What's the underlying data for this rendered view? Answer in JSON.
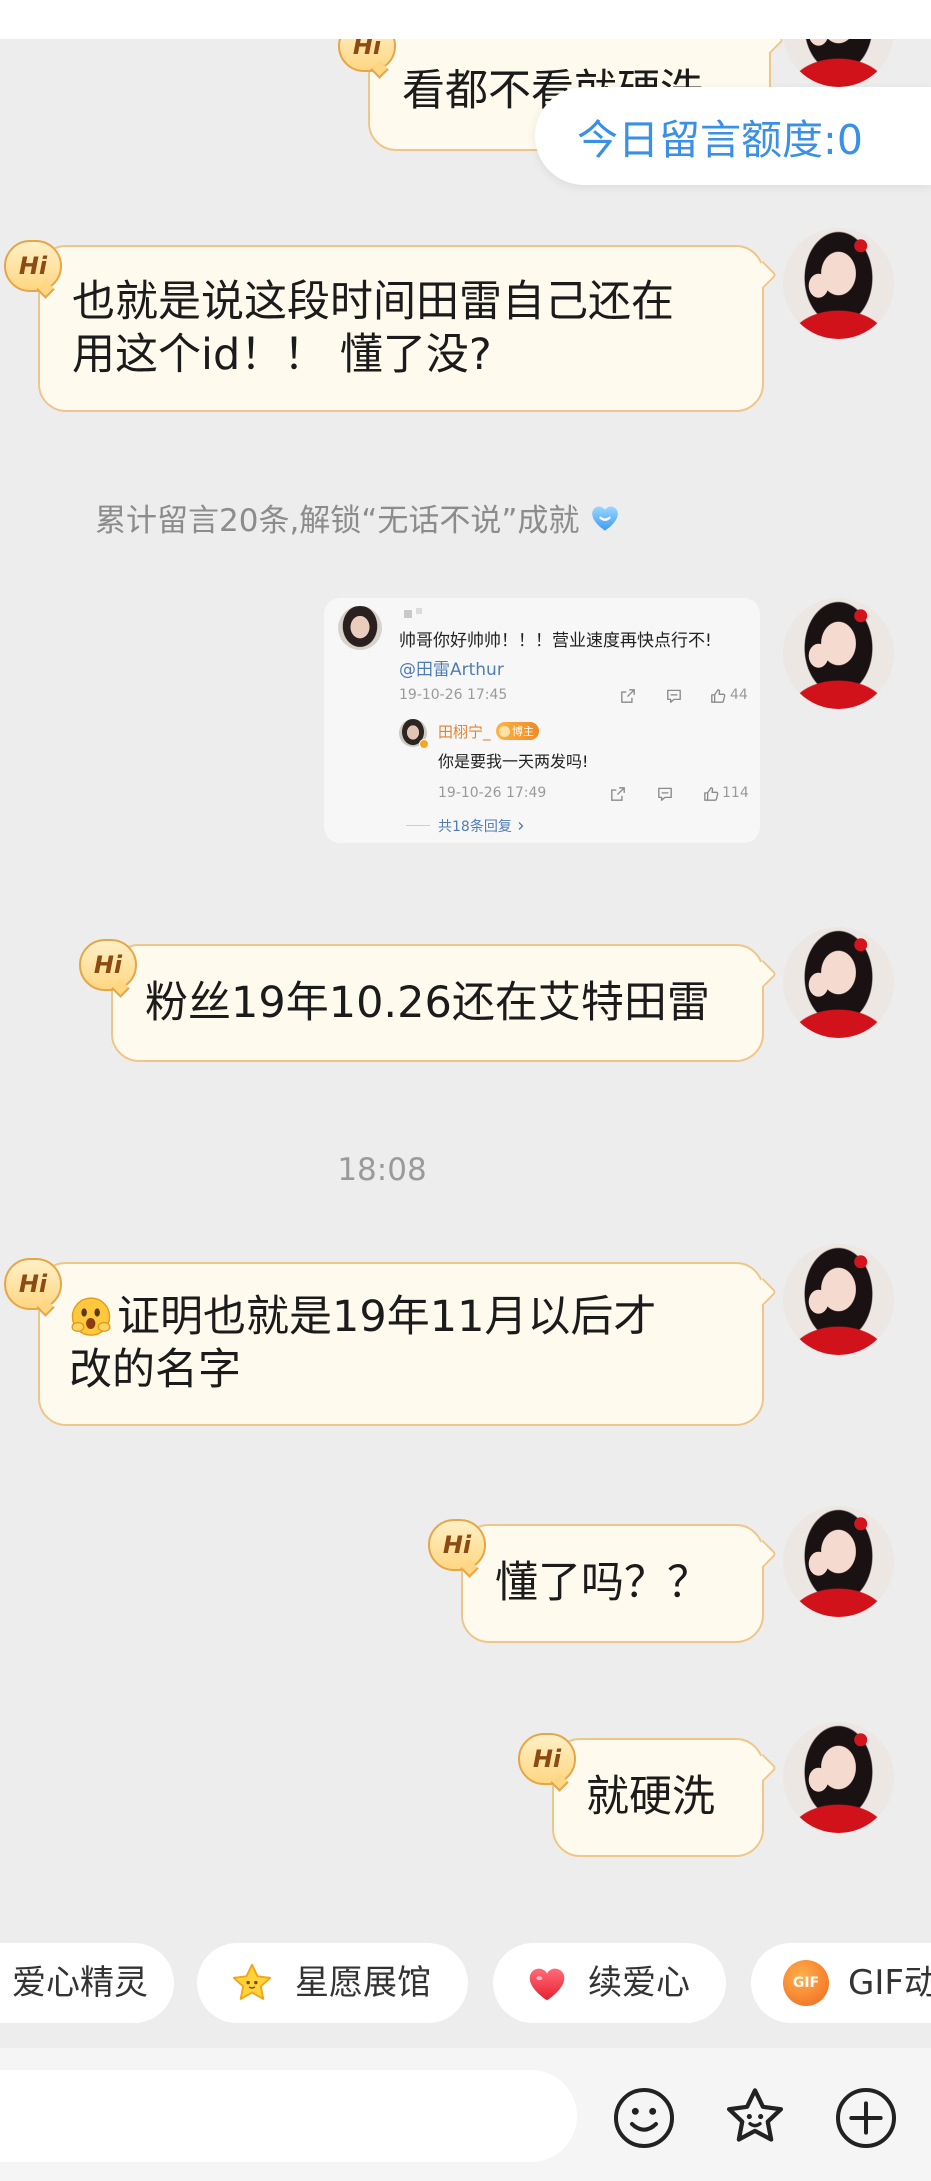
{
  "colors": {
    "page_bg": "#ededed",
    "bubble_bg": "#fffaee",
    "bubble_border": "#efc689",
    "quota_text": "#3a8fe6",
    "link_blue": "#4f7db8",
    "reply_author": "#e5822c"
  },
  "quota_pill": {
    "label": "今日留言额度:0"
  },
  "hi_badge": {
    "label": "Hi"
  },
  "messages": {
    "m1": {
      "lines": [
        "看都不看就硬洗"
      ]
    },
    "m2": {
      "lines": [
        "也就是说这段时间田雷自己还在",
        "用这个id！！ 懂了没?"
      ]
    },
    "m3": {
      "lines": [
        "粉丝19年10.26还在艾特田雷"
      ]
    },
    "m4": {
      "emoji": "mouth-covering-face-icon",
      "lines": [
        "证明也就是19年11月以后才",
        "改的名字"
      ]
    },
    "m5": {
      "lines": [
        "懂了吗？？"
      ]
    },
    "m6": {
      "lines": [
        "就硬洗"
      ]
    }
  },
  "system_notice": {
    "text": "累计留言20条,解锁“无话不说”成就",
    "icon": "blue-heart-icon"
  },
  "image_message": {
    "comment": {
      "text": "帅哥你好帅帅！！！营业速度再快点行不!",
      "mention": "@田雷Arthur",
      "time": "19-10-26 17:45",
      "likes": "44"
    },
    "reply": {
      "author": "田栩宁_",
      "badge": "博主",
      "text": "你是要我一天两发吗!",
      "time": "19-10-26 17:49",
      "likes": "114"
    },
    "more_replies": "共18条回复"
  },
  "timestamp": "18:08",
  "quick_actions": [
    {
      "label": "爱心精灵"
    },
    {
      "label": "星愿展馆",
      "icon": "star-icon"
    },
    {
      "label": "续爱心",
      "icon": "heart-icon"
    },
    {
      "label": "GIF动",
      "icon": "gif-icon",
      "icon_text": "GIF"
    }
  ],
  "input_bar": {
    "icons": [
      "emoji-smiley-icon",
      "star-sticker-icon",
      "plus-circle-icon"
    ]
  }
}
